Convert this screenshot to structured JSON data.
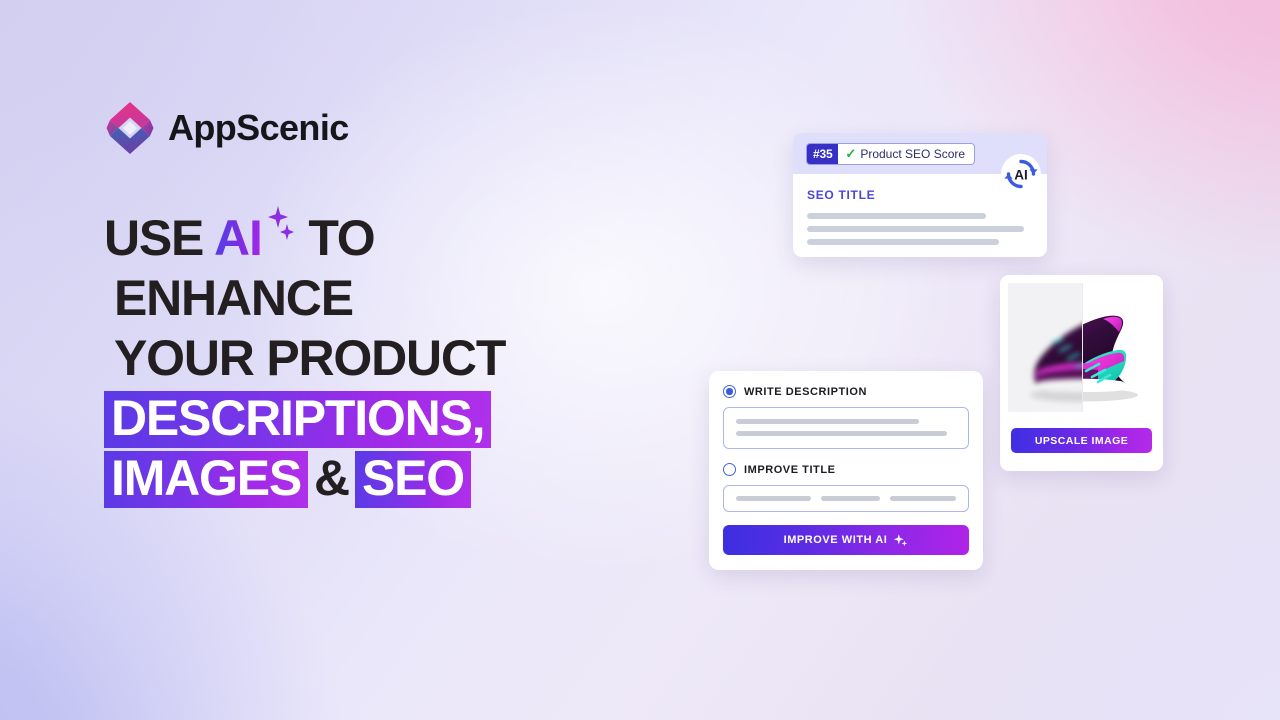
{
  "brand": {
    "name": "AppScenic",
    "logo_icon": "appscenic-diamond-logo",
    "logo_color_top": "#e0318c",
    "logo_color_bottom": "#3b55a8"
  },
  "background": {
    "top_left": "#d3d0f0",
    "top_right": "#f2c4e0",
    "bottom_left": "#bfc0f0",
    "bottom_right": "#e4e0f7"
  },
  "headline": {
    "line1_pre": "USE ",
    "line1_ai": "AI",
    "line1_post": " TO",
    "line2": "ENHANCE",
    "line3": "YOUR PRODUCT",
    "line4_highlight": "DESCRIPTIONS,",
    "line5_highlight_a": "IMAGES",
    "line5_amp": "&",
    "line5_highlight_b": "SEO",
    "ai_gradient_start": "#4b42e8",
    "ai_gradient_end": "#a726e8",
    "highlight_gradient_start": "#5a3ae6",
    "highlight_gradient_end": "#b030ea"
  },
  "seo_card": {
    "score_number": "#35",
    "check_icon": "green-check-icon",
    "score_label": "Product SEO Score",
    "refresh_icon": "ai-refresh-icon",
    "refresh_icon_label": "AI",
    "title_label": "SEO TITLE",
    "badge_bg": "#3730c4",
    "band_bg": "#dfdefb",
    "check_color": "#22b040"
  },
  "shoe_card": {
    "image_alt": "running-shoe-before-after",
    "upscale_button": "UPSCALE IMAGE",
    "button_gradient_start": "#3d2fe2",
    "button_gradient_end": "#b52ae9"
  },
  "form_card": {
    "option_write_description": "WRITE DESCRIPTION",
    "option_write_description_selected": true,
    "option_improve_title": "IMPROVE TITLE",
    "option_improve_title_selected": false,
    "improve_button": "IMPROVE WITH AI",
    "improve_button_icon": "sparkle-icon",
    "button_gradient_start": "#3b2fe0",
    "button_gradient_end": "#b024e8",
    "radio_color": "#3b5ce0"
  }
}
